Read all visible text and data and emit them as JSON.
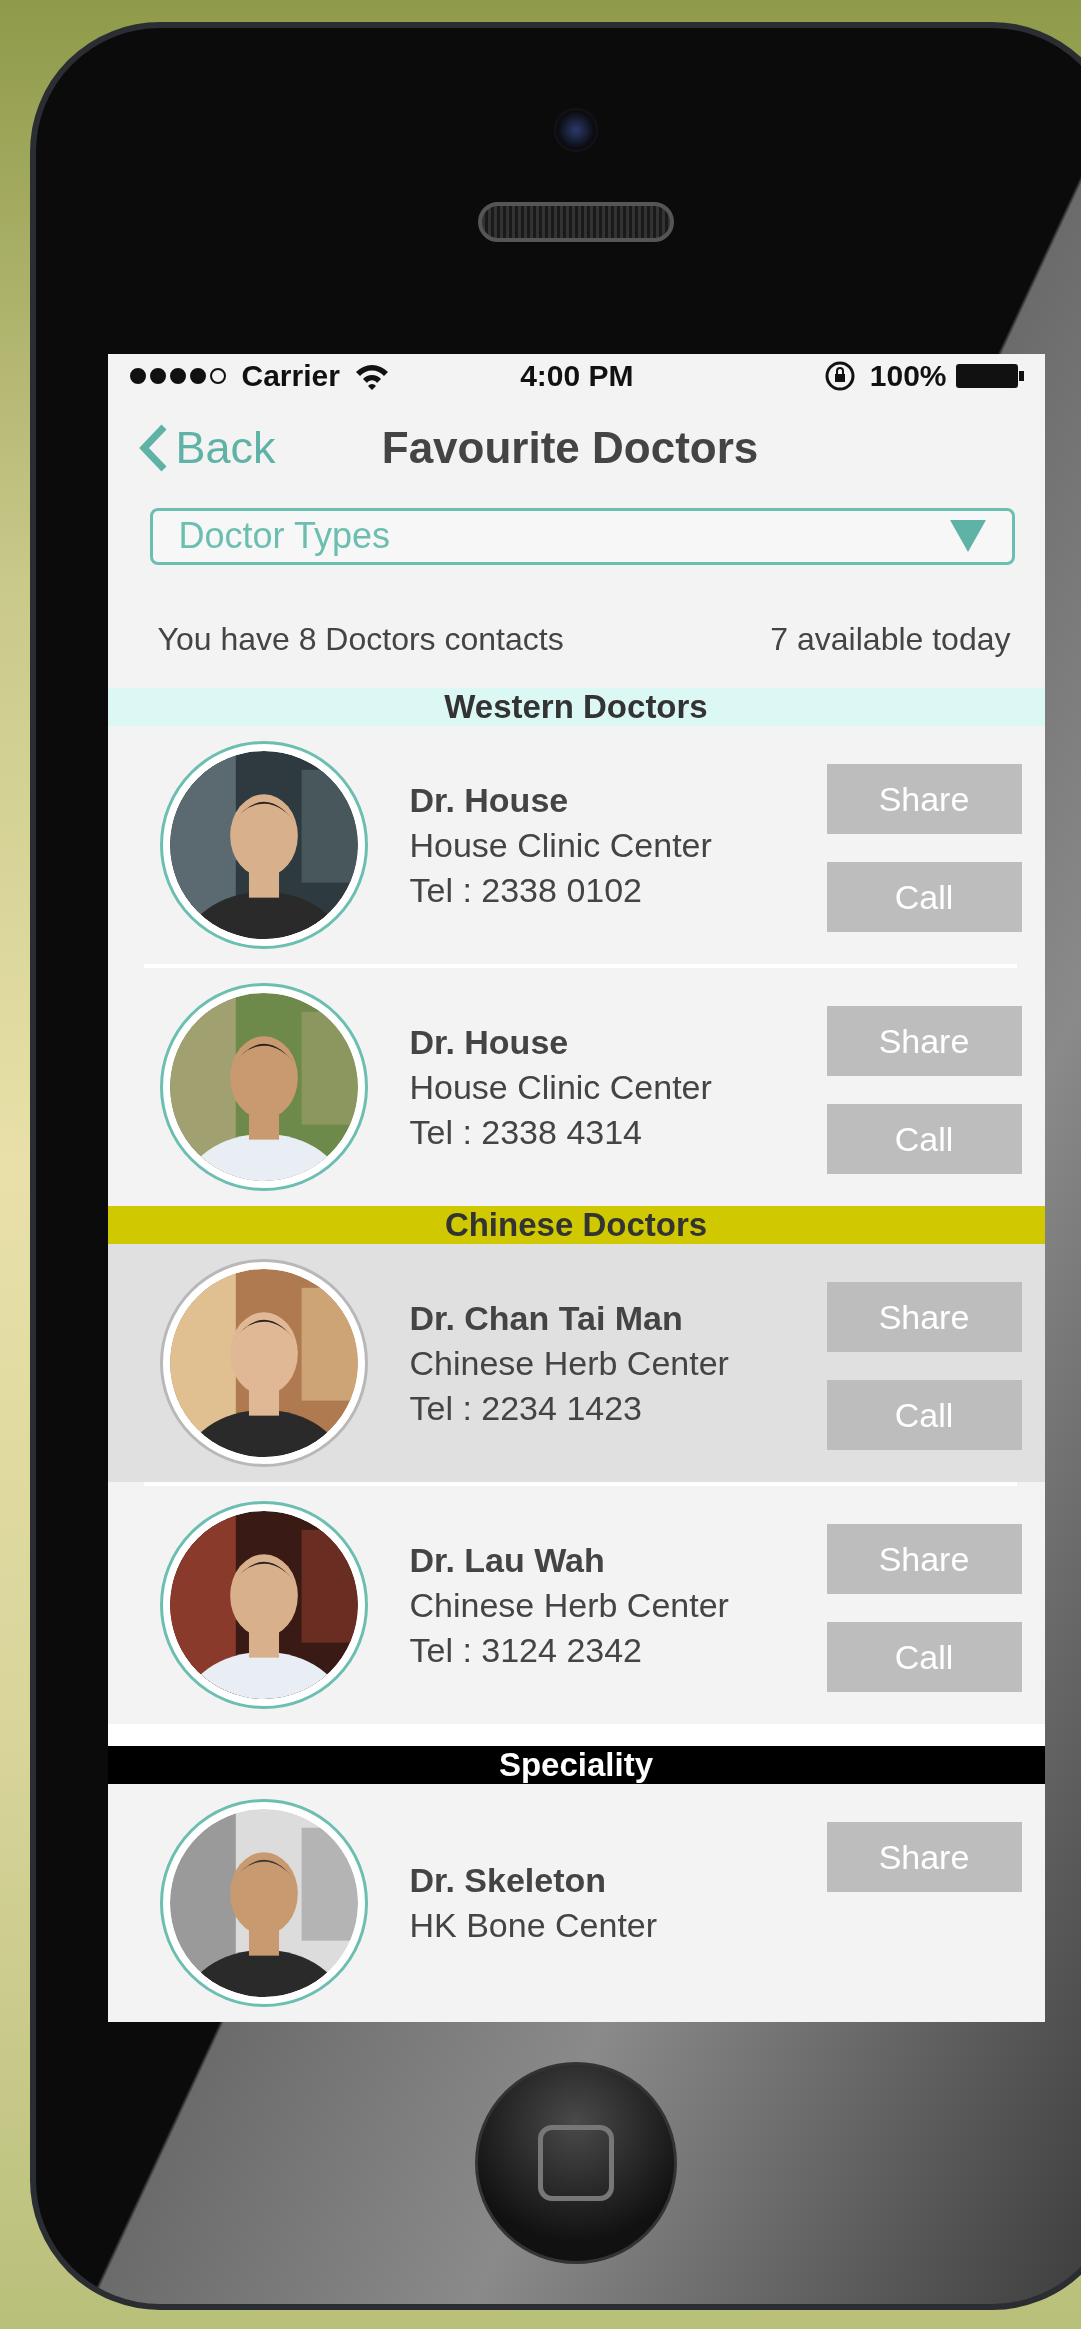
{
  "status_bar": {
    "carrier": "Carrier",
    "time": "4:00 PM",
    "battery": "100%"
  },
  "nav": {
    "back": "Back",
    "title": "Favourite Doctors"
  },
  "filter": {
    "label": "Doctor Types"
  },
  "summary": {
    "contacts": "You have 8 Doctors contacts",
    "available": "7 available today"
  },
  "sections": [
    {
      "title": "Western Doctors",
      "color": "#dcf8f4",
      "doctors": [
        {
          "name": "Dr. House",
          "clinic": "House Clinic Center",
          "tel": "Tel : 2338 0102",
          "selected": false,
          "actions": [
            "Share",
            "Call"
          ]
        },
        {
          "name": "Dr. House",
          "clinic": "House Clinic Center",
          "tel": "Tel : 2338 4314",
          "selected": false,
          "actions": [
            "Share",
            "Call"
          ]
        }
      ]
    },
    {
      "title": "Chinese Doctors",
      "color": "#d0c800",
      "doctors": [
        {
          "name": "Dr. Chan Tai Man",
          "clinic": "Chinese Herb Center",
          "tel": "Tel : 2234 1423",
          "selected": true,
          "actions": [
            "Share",
            "Call"
          ]
        },
        {
          "name": "Dr. Lau Wah",
          "clinic": "Chinese Herb Center",
          "tel": "Tel : 3124 2342",
          "selected": false,
          "actions": [
            "Share",
            "Call"
          ]
        }
      ]
    },
    {
      "title": "Speciality",
      "color": "#000000",
      "doctors": [
        {
          "name": "Dr. Skeleton",
          "clinic": "HK Bone Center",
          "selected": false,
          "actions": [
            "Share"
          ]
        }
      ]
    }
  ]
}
